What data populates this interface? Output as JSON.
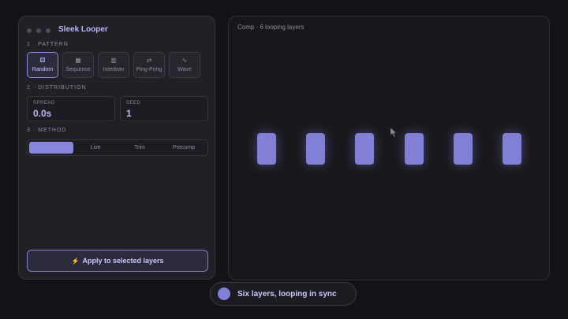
{
  "panel": {
    "title": "Sleek Looper",
    "sections": {
      "pattern": "1 · PATTERN",
      "distribution": "2 · DISTRIBUTION",
      "method": "3 · METHOD"
    },
    "patterns": [
      {
        "label": "Random",
        "icon": "dice-icon",
        "glyph": "⚄",
        "active": true
      },
      {
        "label": "Sequence",
        "icon": "grid-icon",
        "glyph": "▦",
        "active": false
      },
      {
        "label": "Interleav",
        "icon": "stripes-icon",
        "glyph": "▥",
        "active": false
      },
      {
        "label": "Ping-Pong",
        "icon": "swap-icon",
        "glyph": "⇄",
        "active": false
      },
      {
        "label": "Wave",
        "icon": "wave-icon",
        "glyph": "∿",
        "active": false
      }
    ],
    "spread": {
      "label": "SPREAD",
      "value": "0.0s"
    },
    "seed": {
      "label": "SEED",
      "value": "1"
    },
    "methods": [
      {
        "label": "",
        "active": true
      },
      {
        "label": "Live",
        "active": false
      },
      {
        "label": "Trim",
        "active": false
      },
      {
        "label": "Precomp",
        "active": false
      }
    ],
    "apply_label": "Apply to selected layers"
  },
  "comp": {
    "label": "Comp · 6 looping layers",
    "layer_count": 6
  },
  "toast": {
    "text": "Six layers, looping in sync"
  },
  "colors": {
    "accent": "#8180d6",
    "background": "#131317",
    "panel": "#202026"
  }
}
